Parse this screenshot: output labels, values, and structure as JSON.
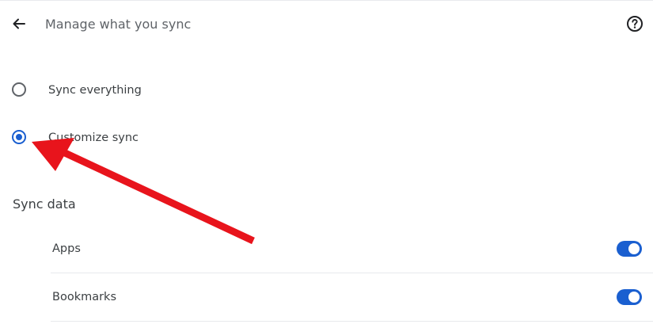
{
  "header": {
    "back_icon": "arrow-back-icon",
    "title": "Manage what you sync",
    "help_icon": "help-circle-icon"
  },
  "sync_options": [
    {
      "label": "Sync everything",
      "selected": false
    },
    {
      "label": "Customize sync",
      "selected": true
    }
  ],
  "sync_data": {
    "title": "Sync data",
    "items": [
      {
        "label": "Apps",
        "enabled": true
      },
      {
        "label": "Bookmarks",
        "enabled": true
      }
    ]
  },
  "colors": {
    "accent": "#1a5fd0",
    "annotation_arrow": "#e8141c",
    "title_text": "#5f6368",
    "body_text": "#3c4043",
    "divider": "#e8eaed"
  },
  "annotation": {
    "type": "red-arrow",
    "points_to": "Customize sync radio"
  }
}
